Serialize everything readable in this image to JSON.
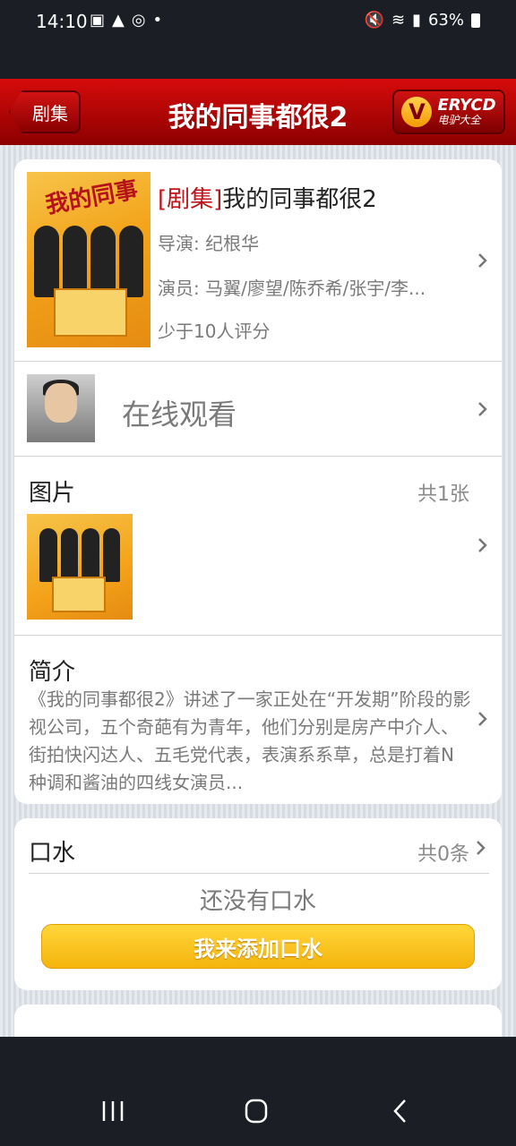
{
  "status_bar": {
    "time": "14:10",
    "battery": "63%"
  },
  "header": {
    "back_label": "剧集",
    "title": "我的同事都很2",
    "logo_text": "ERYCD",
    "logo_sub": "电驴大全"
  },
  "movie": {
    "tag": "[剧集]",
    "title": "我的同事都很2",
    "director": "导演: 纪根华",
    "actors": "演员: 马翼/廖望/陈乔希/张宇/李...",
    "rating": "少于10人评分"
  },
  "watch": {
    "label": "在线观看"
  },
  "pictures": {
    "title": "图片",
    "count": "共1张"
  },
  "intro": {
    "title": "简介",
    "text": "《我的同事都很2》讲述了一家正处在“开发期”阶段的影视公司，五个奇葩有为青年，他们分别是房产中介人、街拍快闪达人、五毛党代表，表演系系草，总是打着N种调和酱油的四线女演员..."
  },
  "comments": {
    "title": "口水",
    "count": "共0条",
    "empty_text": "还没有口水",
    "add_button": "我来添加口水"
  },
  "colors": {
    "header_red": "#c40505",
    "tag_red": "#c0141a",
    "button_yellow": "#f9c820"
  }
}
